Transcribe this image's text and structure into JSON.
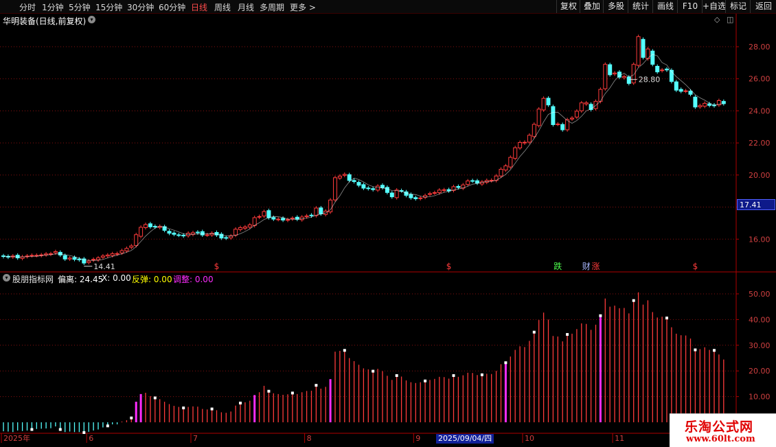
{
  "toolbar": {
    "periods": [
      {
        "label": "分时",
        "active": false
      },
      {
        "label": "1分钟",
        "active": false
      },
      {
        "label": "5分钟",
        "active": false
      },
      {
        "label": "15分钟",
        "active": false
      },
      {
        "label": "30分钟",
        "active": false
      },
      {
        "label": "60分钟",
        "active": false
      },
      {
        "label": "日线",
        "active": true
      },
      {
        "label": "周线",
        "active": false
      },
      {
        "label": "月线",
        "active": false
      },
      {
        "label": "多周期",
        "active": false
      },
      {
        "label": "更多 >",
        "active": false
      }
    ],
    "right_buttons": [
      "复权",
      "叠加",
      "多股",
      "统计",
      "画线",
      "F10",
      "+自选",
      "标记",
      "返回"
    ]
  },
  "title": {
    "text": "华明装备(日线,前复权)",
    "dropdown_icon": "chevron-down-icon"
  },
  "corner_icons": [
    "diamond-icon",
    "panel-toggle-icon"
  ],
  "colors": {
    "up": "#ff3b3b",
    "down": "#54ffff",
    "grid": "#8a1010",
    "axis": "#b00000",
    "ma": "#ffffff",
    "magenta": "#ff2cff",
    "label_green": "#4cff4c",
    "label_red": "#ff3b3b",
    "label_blue": "#aab8ff"
  },
  "indicator": {
    "name": "股朋指标网",
    "items": [
      {
        "label": "偏离:",
        "value": "24.45",
        "color": "#ffffff"
      },
      {
        "label": "X:",
        "value": "0.00",
        "color": "#ffffff"
      },
      {
        "label": "反弹:",
        "value": "0.00",
        "color": "#ffff00"
      },
      {
        "label": "调整:",
        "value": "0.00",
        "color": "#ff2cff"
      }
    ]
  },
  "price_tag": "17.41",
  "cursor_date": "2025/09/04/四",
  "watermark": {
    "name": "乐淘公式网",
    "url": "www.60lt.com"
  },
  "chart_data": [
    {
      "type": "candlestick",
      "title": "华明装备(日线,前复权)",
      "ylim": [
        14.0,
        29.2
      ],
      "y_ticks": [
        "16.00",
        "18.00",
        "20.00",
        "22.00",
        "24.00",
        "26.00",
        "28.00"
      ],
      "y_tick_values": [
        16,
        18,
        20,
        22,
        24,
        26,
        28
      ],
      "high_mark": "28.80",
      "low_mark": "14.41",
      "high_index": 132,
      "low_index": 17,
      "annotations": [
        {
          "text": "$",
          "index": 45,
          "color": "#ff3b3b"
        },
        {
          "text": "$",
          "index": 94,
          "color": "#ff3b3b"
        },
        {
          "text": "跌",
          "index": 117,
          "color": "#4cff4c"
        },
        {
          "text": "财",
          "index": 123,
          "color": "#aab8ff"
        },
        {
          "text": "涨",
          "index": 125,
          "color": "#ff3b3b"
        },
        {
          "text": "$",
          "index": 146,
          "color": "#ff3b3b"
        }
      ],
      "closes": [
        14.92,
        14.88,
        14.95,
        14.83,
        14.9,
        14.95,
        14.99,
        14.99,
        15.02,
        15.08,
        15.09,
        15.22,
        15.01,
        14.76,
        14.82,
        14.74,
        14.71,
        14.51,
        14.63,
        14.74,
        14.83,
        14.95,
        15.01,
        15.09,
        15.1,
        15.28,
        15.42,
        15.58,
        16.28,
        16.74,
        16.91,
        16.77,
        16.76,
        16.8,
        16.55,
        16.37,
        16.3,
        16.25,
        16.2,
        16.37,
        16.4,
        16.4,
        16.26,
        16.27,
        16.37,
        16.26,
        16.07,
        16.07,
        16.2,
        16.62,
        16.72,
        16.76,
        16.89,
        17.34,
        17.41,
        17.72,
        17.34,
        17.25,
        17.25,
        17.19,
        17.22,
        17.31,
        17.24,
        17.38,
        17.45,
        17.46,
        17.94,
        17.58,
        17.75,
        18.44,
        19.83,
        19.93,
        20.04,
        19.66,
        19.59,
        19.36,
        19.18,
        19.15,
        19.09,
        19.31,
        19.21,
        18.91,
        18.64,
        19.06,
        19.02,
        18.73,
        18.58,
        18.52,
        18.57,
        18.72,
        18.84,
        18.9,
        19.06,
        19.08,
        19.01,
        19.27,
        19.22,
        19.38,
        19.63,
        19.63,
        19.5,
        19.57,
        19.66,
        19.67,
        19.94,
        20.36,
        20.57,
        21.1,
        21.7,
        22.03,
        22.04,
        22.48,
        23.16,
        24.11,
        24.78,
        24.37,
        23.14,
        23.18,
        22.82,
        23.45,
        23.55,
        23.98,
        24.5,
        24.5,
        24.08,
        24.59,
        25.34,
        26.9,
        26.25,
        26.36,
        26.1,
        26.14,
        25.71,
        26.9,
        28.63,
        27.33,
        27.86,
        26.9,
        26.43,
        26.55,
        26.55,
        25.83,
        25.29,
        25.22,
        25.25,
        25.03,
        24.24,
        24.33,
        24.47,
        24.34,
        24.32,
        24.64,
        24.45
      ],
      "opens": [
        14.96,
        14.93,
        14.89,
        15.0,
        14.8,
        14.92,
        14.97,
        14.99,
        14.98,
        15.02,
        15.06,
        15.15,
        15.18,
        14.98,
        14.76,
        14.86,
        14.76,
        14.77,
        14.54,
        14.7,
        14.71,
        14.87,
        14.95,
        14.98,
        15.08,
        15.14,
        15.27,
        15.49,
        15.6,
        16.18,
        16.72,
        16.96,
        16.8,
        16.73,
        16.78,
        16.49,
        16.38,
        16.27,
        16.25,
        16.21,
        16.3,
        16.44,
        16.47,
        16.26,
        16.26,
        16.42,
        16.31,
        16.1,
        16.08,
        16.25,
        16.6,
        16.68,
        16.75,
        16.85,
        17.37,
        17.44,
        17.78,
        17.35,
        17.23,
        17.3,
        17.18,
        17.26,
        17.37,
        17.21,
        17.4,
        17.5,
        17.47,
        17.95,
        17.54,
        17.7,
        18.45,
        19.81,
        19.98,
        20.02,
        19.66,
        19.54,
        19.4,
        19.19,
        19.15,
        19.06,
        19.36,
        19.23,
        18.88,
        18.59,
        19.03,
        18.95,
        18.79,
        18.59,
        18.53,
        18.61,
        18.79,
        18.88,
        18.9,
        19.04,
        19.09,
        19.04,
        19.29,
        19.18,
        19.41,
        19.65,
        19.64,
        19.44,
        19.55,
        19.65,
        19.66,
        19.94,
        20.31,
        20.5,
        21.04,
        21.69,
        22.0,
        22.05,
        22.4,
        23.08,
        24.06,
        24.79,
        24.27,
        23.17,
        23.15,
        22.82,
        23.49,
        23.61,
        24.0,
        24.43,
        24.41,
        24.14,
        24.59,
        25.38,
        26.88,
        26.3,
        26.42,
        26.07,
        26.11,
        25.74,
        26.84,
        28.46,
        27.25,
        27.73,
        26.78,
        26.51,
        26.61,
        26.53,
        25.81,
        25.34,
        25.23,
        25.23,
        24.86,
        24.25,
        24.29,
        24.44,
        24.37,
        24.37,
        24.59
      ]
    },
    {
      "type": "bar",
      "title": "股朋指标网",
      "ylim": [
        -4.0,
        54.0
      ],
      "y_ticks": [
        "10.00",
        "20.00",
        "30.00",
        "40.00",
        "50.00"
      ],
      "y_tick_values": [
        10,
        20,
        30,
        40,
        50
      ],
      "series_name": "偏离",
      "x_ticks": [
        {
          "label": "2025年",
          "index": 0
        },
        {
          "label": "6",
          "index": 18
        },
        {
          "label": "7",
          "index": 40
        },
        {
          "label": "8",
          "index": 64
        },
        {
          "label": "9",
          "index": 87
        },
        {
          "label": "10",
          "index": 110
        },
        {
          "label": "11",
          "index": 129
        }
      ],
      "values": [
        -3.5,
        -3.6,
        -3.8,
        -3.2,
        -3.4,
        -3.2,
        -2.8,
        -2.6,
        -2.5,
        -2.4,
        -2.3,
        -1.6,
        -2.8,
        -3.8,
        -3.6,
        -3.8,
        -3.8,
        -4.0,
        -3.7,
        -3.2,
        -2.8,
        -2.0,
        -1.4,
        -0.8,
        -0.8,
        0.3,
        0.8,
        1.7,
        8.0,
        11.0,
        11.5,
        10.2,
        9.5,
        9.0,
        8.0,
        7.1,
        6.4,
        6.0,
        5.6,
        6.0,
        6.2,
        6.1,
        5.2,
        5.0,
        5.2,
        4.7,
        3.9,
        3.7,
        4.2,
        6.5,
        7.5,
        7.8,
        8.4,
        10.6,
        11.7,
        14.2,
        12.1,
        11.3,
        11.0,
        10.7,
        10.9,
        11.4,
        11.0,
        11.7,
        12.2,
        12.3,
        14.4,
        13.1,
        13.8,
        16.8,
        27.5,
        27.8,
        28.0,
        25.0,
        23.8,
        22.4,
        21.0,
        20.6,
        19.9,
        20.8,
        19.9,
        18.1,
        16.5,
        18.2,
        17.8,
        16.3,
        15.6,
        15.3,
        15.6,
        16.1,
        16.5,
        16.9,
        17.7,
        17.6,
        17.0,
        18.2,
        17.7,
        18.3,
        19.3,
        19.2,
        18.4,
        18.5,
        18.9,
        18.8,
        20.0,
        22.6,
        23.2,
        25.6,
        28.2,
        29.6,
        29.3,
        31.7,
        35.1,
        39.8,
        42.7,
        40.0,
        33.6,
        33.4,
        31.5,
        34.2,
        34.5,
        36.3,
        38.5,
        38.3,
        36.0,
        38.0,
        41.5,
        48.2,
        45.0,
        45.4,
        44.4,
        44.5,
        42.4,
        47.4,
        50.6,
        45.8,
        47.5,
        42.9,
        40.8,
        41.1,
        40.6,
        37.0,
        34.5,
        33.9,
        33.8,
        32.6,
        28.2,
        28.5,
        29.2,
        28.2,
        28.0,
        26.4,
        24.45
      ],
      "highlight_indices": [
        28,
        29,
        53,
        69,
        106,
        126
      ],
      "marker_indices": [
        6,
        12,
        17,
        22,
        27,
        32,
        38,
        44,
        50,
        56,
        61,
        66,
        72,
        78,
        83,
        89,
        95,
        101,
        106,
        112,
        119,
        126,
        133,
        140,
        146,
        150
      ]
    }
  ]
}
